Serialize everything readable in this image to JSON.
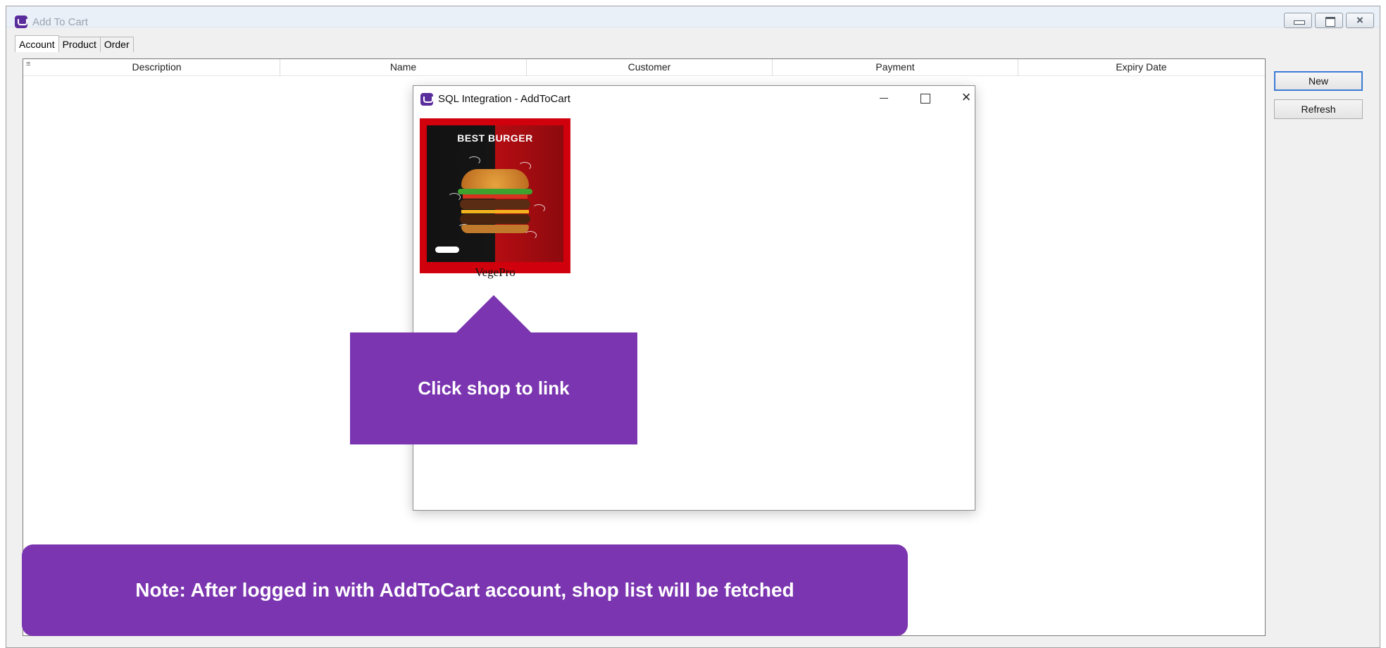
{
  "window": {
    "title": "Add To Cart",
    "controls": {
      "minimize": "minimize-icon",
      "maximize": "maximize-icon",
      "close": "×"
    }
  },
  "tabs": [
    {
      "label": "Account",
      "active": true
    },
    {
      "label": "Product",
      "active": false
    },
    {
      "label": "Order",
      "active": false
    }
  ],
  "grid": {
    "columns": [
      "Description",
      "Name",
      "Customer",
      "Payment",
      "Expiry Date"
    ],
    "rows": []
  },
  "actions": {
    "new_label": "New",
    "refresh_label": "Refresh"
  },
  "dialog": {
    "title": "SQL Integration - AddToCart",
    "close_glyph": "×",
    "shop": {
      "image_title": "BEST BURGER",
      "name": "VegePro",
      "highlight_color": "#d0000c"
    }
  },
  "callout": {
    "text": "Click shop to link",
    "color": "#7b35b0"
  },
  "note": {
    "text": "Note: After logged in with AddToCart account, shop list will be fetched"
  }
}
